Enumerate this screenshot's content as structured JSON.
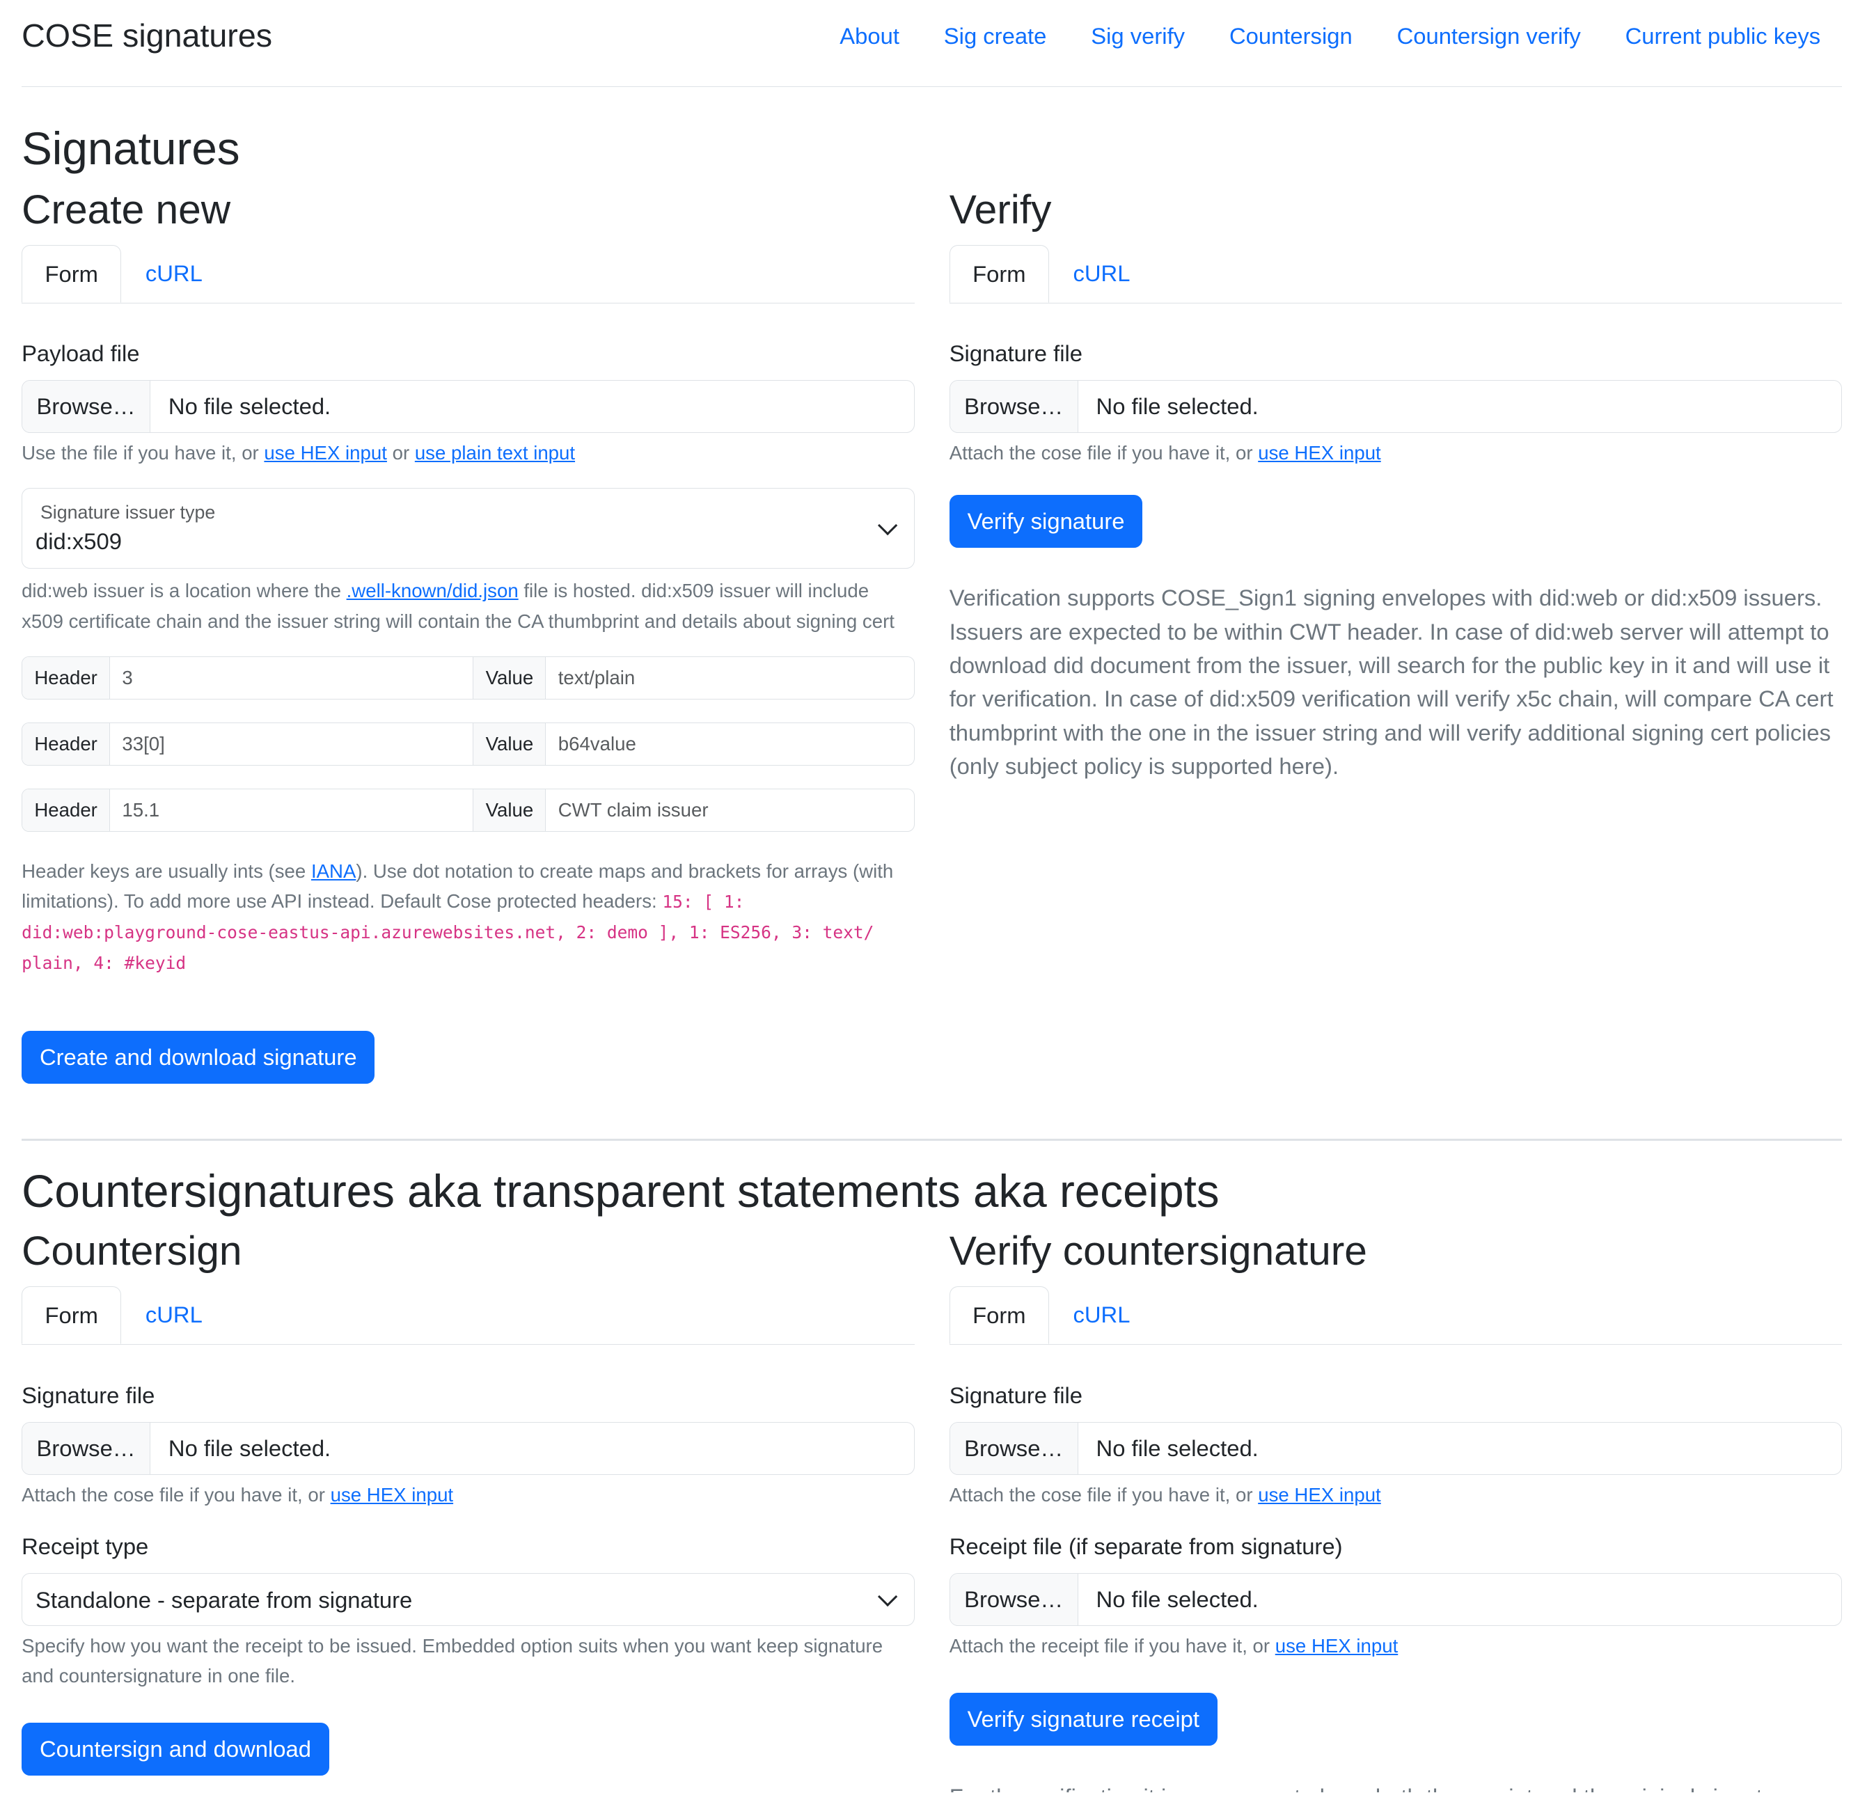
{
  "header": {
    "brand": "COSE signatures",
    "nav": [
      "About",
      "Sig create",
      "Sig verify",
      "Countersign",
      "Countersign verify",
      "Current public keys"
    ]
  },
  "signatures": {
    "title": "Signatures",
    "create": {
      "title": "Create new",
      "tabs": {
        "form": "Form",
        "curl": "cURL"
      },
      "payload_label": "Payload file",
      "browse": "Browse…",
      "no_file": "No file selected.",
      "help_prefix": "Use the file if you have it, or ",
      "help_link1": "use HEX input",
      "help_mid": " or ",
      "help_link2": "use plain text input",
      "issuer_select_label": "Signature issuer type",
      "issuer_select_value": "did:x509",
      "issuer_help_prefix": "did:web issuer is a location where the ",
      "issuer_help_link": ".well-known/did.json",
      "issuer_help_suffix": " file is hosted. did:x509 issuer will include x509 certificate chain and the issuer string will contain the CA thumbprint and details about signing cert",
      "header_label": "Header",
      "value_label": "Value",
      "headers": [
        {
          "key": "3",
          "value": "text/plain"
        },
        {
          "key": "33[0]",
          "value": "b64value"
        },
        {
          "key": "15.1",
          "value": "CWT claim issuer"
        }
      ],
      "headers_help_prefix": "Header keys are usually ints (see ",
      "headers_help_link": "IANA",
      "headers_help_suffix": "). Use dot notation to create maps and brackets for arrays (with limitations). To add more use API instead. Default Cose protected headers: ",
      "headers_help_code": "15: [ 1: did:web:playground-cose-eastus-api.azurewebsites.net, 2: demo ], 1: ES256, 3: text/ plain, 4: #keyid",
      "submit": "Create and download signature"
    },
    "verify": {
      "title": "Verify",
      "tabs": {
        "form": "Form",
        "curl": "cURL"
      },
      "sig_label": "Signature file",
      "browse": "Browse…",
      "no_file": "No file selected.",
      "help_prefix": "Attach the cose file if you have it, or ",
      "help_link": "use HEX input",
      "submit": "Verify signature",
      "description": "Verification supports COSE_Sign1 signing envelopes with did:web or did:x509 issuers. Issuers are expected to be within CWT header. In case of did:web server will attempt to download did document from the issuer, will search for the public key in it and will use it for verification. In case of did:x509 verification will verify x5c chain, will compare CA cert thumbprint with the one in the issuer string and will verify additional signing cert policies (only subject policy is supported here)."
    }
  },
  "countersignatures": {
    "title": "Countersignatures aka transparent statements aka receipts",
    "countersign": {
      "title": "Countersign",
      "tabs": {
        "form": "Form",
        "curl": "cURL"
      },
      "sig_label": "Signature file",
      "browse": "Browse…",
      "no_file": "No file selected.",
      "help_prefix": "Attach the cose file if you have it, or ",
      "help_link": "use HEX input",
      "receipt_type_label": "Receipt type",
      "receipt_type_value": "Standalone - separate from signature",
      "receipt_type_help": "Specify how you want the receipt to be issued. Embedded option suits when you want keep signature and countersignature in one file.",
      "submit": "Countersign and download"
    },
    "verify": {
      "title": "Verify countersignature",
      "tabs": {
        "form": "Form",
        "curl": "cURL"
      },
      "sig_label": "Signature file",
      "browse": "Browse…",
      "no_file": "No file selected.",
      "help_prefix": "Attach the cose file if you have it, or ",
      "help_link": "use HEX input",
      "receipt_label": "Receipt file (if separate from signature)",
      "receipt_no_file": "No file selected.",
      "receipt_help_prefix": "Attach the receipt file if you have it, or ",
      "receipt_help_link": "use HEX input",
      "submit": "Verify signature receipt",
      "description": "For the verification it is necessary to have both the receipt and the original signature."
    }
  },
  "colors": {
    "primary": "#0d6efd",
    "border": "#dee2e6",
    "code": "#d63384",
    "muted": "#6c757d"
  }
}
